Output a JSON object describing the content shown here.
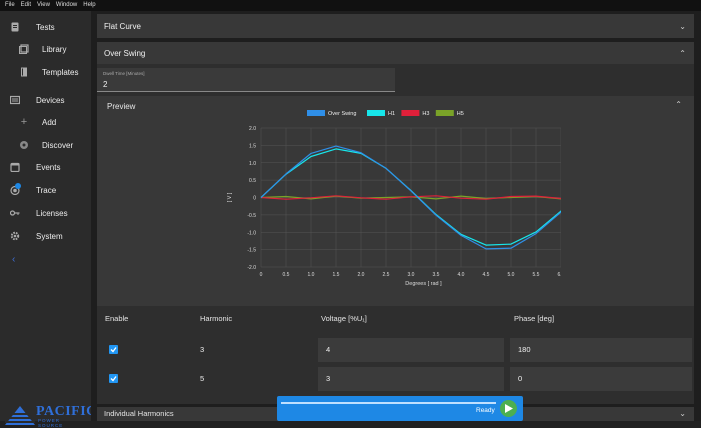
{
  "menu": [
    "File",
    "Edit",
    "View",
    "Window",
    "Help"
  ],
  "sidebar": {
    "items": [
      {
        "label": "Tests",
        "icon": "document-icon"
      },
      {
        "label": "Library",
        "icon": "library-icon"
      },
      {
        "label": "Templates",
        "icon": "templates-icon"
      },
      {
        "label": "Devices",
        "icon": "devices-icon"
      },
      {
        "label": "Add",
        "icon": "plus-icon"
      },
      {
        "label": "Discover",
        "icon": "discover-icon"
      },
      {
        "label": "Events",
        "icon": "calendar-icon"
      },
      {
        "label": "Trace",
        "icon": "trace-icon"
      },
      {
        "label": "Licenses",
        "icon": "key-icon"
      },
      {
        "label": "System",
        "icon": "gear-icon"
      }
    ],
    "logo_text": "PACIFIC",
    "logo_subtext": "POWER SOURCE"
  },
  "panels": {
    "flat_curve": "Flat Curve",
    "over_swing": "Over Swing",
    "individual_harmonics": "Individual Harmonics"
  },
  "dwell": {
    "caption": "Dwell Time [Minutes]",
    "value": "2"
  },
  "preview": {
    "title": "Preview"
  },
  "harmonics_table": {
    "headers": [
      "Enable",
      "Harmonic",
      "Voltage [%U₁]",
      "Phase [deg]"
    ],
    "rows": [
      {
        "enabled": true,
        "harmonic": "3",
        "voltage": "4",
        "phase": "180"
      },
      {
        "enabled": true,
        "harmonic": "5",
        "voltage": "3",
        "phase": "0"
      }
    ]
  },
  "status": {
    "text": "Ready"
  },
  "colors": {
    "accent": "#1e88e5",
    "over_swing": "#2f8fe8",
    "h1": "#17e6ea",
    "h3": "#e0203a",
    "h5": "#7aa328",
    "play": "#4caf50"
  },
  "chart_data": {
    "type": "line",
    "xlabel": "Degrees [ rad ]",
    "ylabel": "[ V ]",
    "xlim": [
      0,
      6.5
    ],
    "ylim": [
      -2.0,
      2.0
    ],
    "xticks": [
      "0",
      "0.5",
      "1.0",
      "1.5",
      "2.0",
      "2.5",
      "3.0",
      "3.5",
      "4.0",
      "4.5",
      "5.0",
      "5.5",
      "6.0",
      "6.5"
    ],
    "yticks": [
      "2.0",
      "1.5",
      "1.0",
      "0.5",
      "0",
      "-0.5",
      "-1.0",
      "-1.5",
      "-2.0"
    ],
    "legend_position": "top",
    "series": [
      {
        "name": "Over Swing",
        "x": [
          0,
          0.5,
          1.0,
          1.5,
          2.0,
          2.5,
          3.0,
          3.5,
          4.0,
          4.5,
          5.0,
          5.5,
          6.0,
          6.28
        ],
        "y": [
          0,
          0.68,
          1.27,
          1.48,
          1.29,
          0.84,
          0.19,
          -0.51,
          -1.09,
          -1.48,
          -1.46,
          -1.04,
          -0.42,
          0
        ]
      },
      {
        "name": "H1",
        "x": [
          0,
          0.5,
          1.0,
          1.5,
          2.0,
          2.5,
          3.0,
          3.5,
          4.0,
          4.5,
          5.0,
          5.5,
          6.0,
          6.28
        ],
        "y": [
          0,
          0.67,
          1.18,
          1.4,
          1.27,
          0.84,
          0.2,
          -0.49,
          -1.06,
          -1.37,
          -1.34,
          -0.99,
          -0.39,
          0
        ]
      },
      {
        "name": "H3",
        "x": [
          0,
          0.5,
          1.0,
          1.5,
          2.0,
          2.5,
          3.0,
          3.5,
          4.0,
          4.5,
          5.0,
          5.5,
          6.0,
          6.28
        ],
        "y": [
          0,
          -0.05,
          -0.01,
          0.05,
          -0.01,
          -0.05,
          0.02,
          0.05,
          -0.02,
          -0.05,
          0.03,
          0.04,
          -0.03,
          0
        ]
      },
      {
        "name": "H5",
        "x": [
          0,
          0.5,
          1.0,
          1.5,
          2.0,
          2.5,
          3.0,
          3.5,
          4.0,
          4.5,
          5.0,
          5.5,
          6.0,
          6.28
        ],
        "y": [
          0,
          0.03,
          -0.04,
          0.04,
          -0.02,
          0.0,
          0.02,
          -0.04,
          0.04,
          -0.03,
          0.0,
          0.03,
          -0.04,
          0
        ]
      }
    ]
  }
}
